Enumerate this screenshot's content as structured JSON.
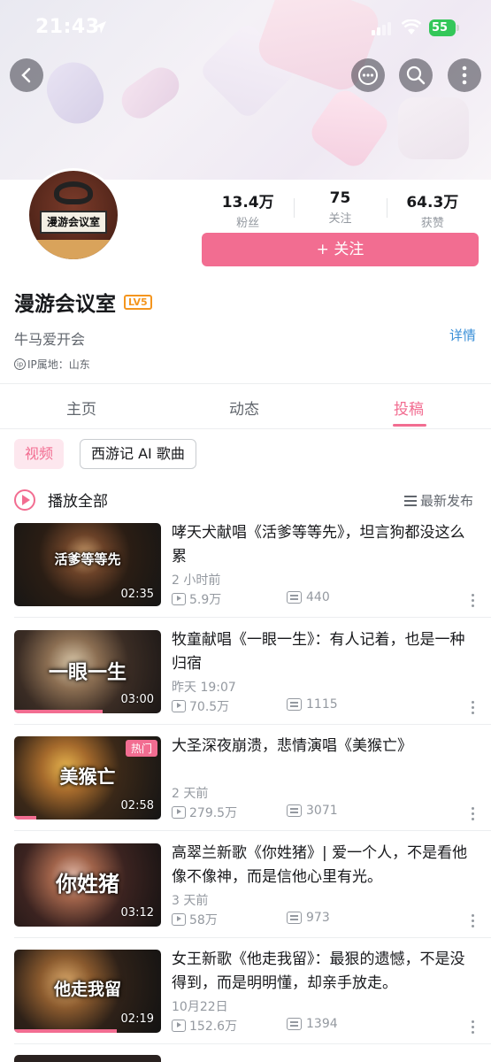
{
  "status_bar": {
    "time": "21:43",
    "battery": "55"
  },
  "profile": {
    "avatar_label": "漫游会议室",
    "stats": [
      {
        "value": "13.4万",
        "label": "粉丝"
      },
      {
        "value": "75",
        "label": "关注"
      },
      {
        "value": "64.3万",
        "label": "获赞"
      }
    ],
    "follow_label": "+ 关注",
    "name": "漫游会议室",
    "level": "LV5",
    "signature": "牛马爱开会",
    "detail_label": "详情",
    "ip_label": "IP属地：山东"
  },
  "tabs": [
    {
      "label": "主页"
    },
    {
      "label": "动态"
    },
    {
      "label": "投稿"
    }
  ],
  "filters": {
    "chip1": "视频",
    "chip2": "西游记 AI 歌曲"
  },
  "list_header": {
    "play_all": "播放全部",
    "sort": "最新发布"
  },
  "videos": [
    {
      "title": "哮天犬献唱《活爹等等先》，坦言狗都没这么累",
      "caption": "活爹等等先",
      "duration": "02:35",
      "date": "2 小时前",
      "views": "5.9万",
      "danmaku": "440",
      "progress": 0,
      "hot": ""
    },
    {
      "title": "牧童献唱《一眼一生》：有人记着，也是一种归宿",
      "caption": "一眼一生",
      "duration": "03:00",
      "date": "昨天 19:07",
      "views": "70.5万",
      "danmaku": "1115",
      "progress": 0.6,
      "hot": ""
    },
    {
      "title": "大圣深夜崩溃，悲情演唱《美猴亡》",
      "caption": "美猴亡",
      "duration": "02:58",
      "date": "2 天前",
      "views": "279.5万",
      "danmaku": "3071",
      "progress": 0.15,
      "hot": "热门"
    },
    {
      "title": "高翠兰新歌《你姓猪》| 爱一个人，不是看他像不像神，而是信他心里有光。",
      "caption": "你姓猪",
      "duration": "03:12",
      "date": "3 天前",
      "views": "58万",
      "danmaku": "973",
      "progress": 0,
      "hot": ""
    },
    {
      "title": "女王新歌《他走我留》：最狠的遗憾，不是没得到，而是明明懂，却亲手放走。",
      "caption": "他走我留",
      "duration": "02:19",
      "date": "10月22日",
      "views": "152.6万",
      "danmaku": "1394",
      "progress": 0.7,
      "hot": ""
    }
  ],
  "colors": {
    "accent": "#f26d91",
    "link": "#3a8fd7",
    "battery": "#34c759"
  }
}
